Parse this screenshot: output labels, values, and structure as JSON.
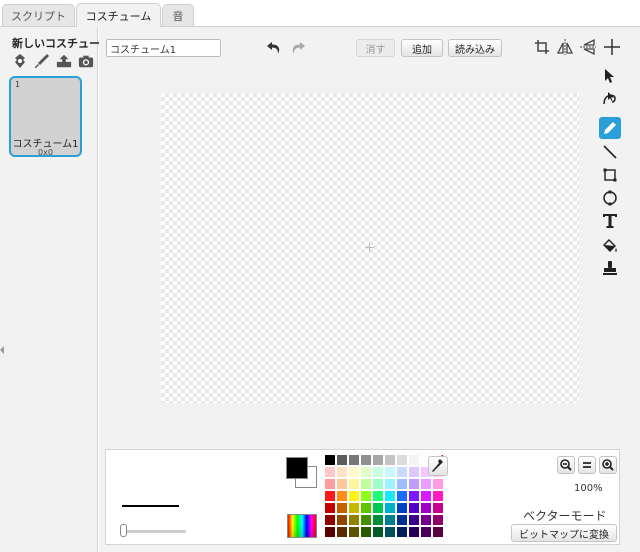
{
  "tabs": [
    {
      "label": "スクリプト"
    },
    {
      "label": "コスチューム"
    },
    {
      "label": "音"
    }
  ],
  "new_costume": {
    "label": "新しいコスチューム:",
    "icons": [
      "character-icon",
      "paintbrush-icon",
      "upload-icon",
      "camera-icon"
    ]
  },
  "costumes": [
    {
      "number": "1",
      "name": "コスチューム1",
      "size": "0x0"
    }
  ],
  "editor": {
    "costume_name": "コスチューム1",
    "clear_label": "消す",
    "add_label": "追加",
    "import_label": "読み込み",
    "zoom_level": "100%",
    "mode_label": "ベクターモード",
    "convert_label": "ビットマップに変換"
  },
  "colors": {
    "accent": "#2a9fd8",
    "primary_color": "#000000",
    "secondary_color": "#ffffff",
    "palette": [
      "#000000",
      "#5b5b5b",
      "#777777",
      "#8f8f8f",
      "#a8a8a8",
      "#c4c4c4",
      "#dcdcdc",
      "#f4f4f4",
      "#ffffff",
      "transparent",
      "#ffc7c7",
      "#ffe2c7",
      "#fffac7",
      "#dfffc7",
      "#c7ffe3",
      "#c7f9ff",
      "#c7dcff",
      "#dcc7ff",
      "#f3c7ff",
      "#ffc7ef",
      "#ff9c9c",
      "#ffc79c",
      "#fff59c",
      "#c2ff9c",
      "#9cffc9",
      "#9cf2ff",
      "#9cbdff",
      "#c09cff",
      "#ea9cff",
      "#ff9ce3",
      "#ff1a1a",
      "#ff8c1a",
      "#fff11a",
      "#8cff1a",
      "#1aff7a",
      "#1ae8ff",
      "#1a6aff",
      "#7a1aff",
      "#d81aff",
      "#ff1ac2",
      "#c70000",
      "#c76100",
      "#c7b800",
      "#5ec700",
      "#00c74f",
      "#00b0c7",
      "#0043c7",
      "#5000c7",
      "#a100c7",
      "#c70091",
      "#8f0000",
      "#8f4600",
      "#8f8400",
      "#438f00",
      "#008f39",
      "#007f8f",
      "#00308f",
      "#39008f",
      "#73008f",
      "#8f0068",
      "#5b0000",
      "#5b2c00",
      "#5b5400",
      "#2b5b00",
      "#005b24",
      "#00515b",
      "#001e5b",
      "#24005b",
      "#49005b",
      "#5b0042"
    ]
  }
}
